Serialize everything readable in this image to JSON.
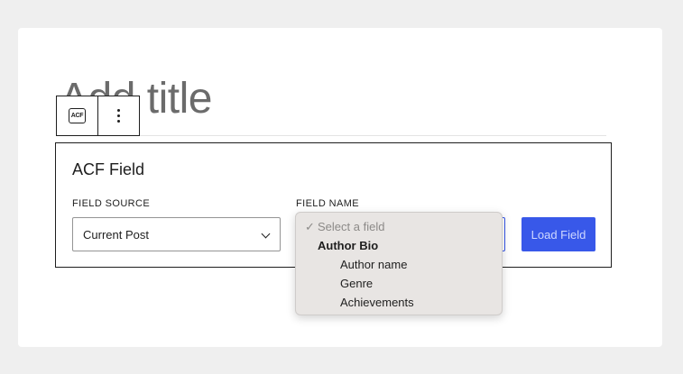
{
  "editor": {
    "title_placeholder": "Add title",
    "toolbar": {
      "block_icon_text": "ACF",
      "more_options": "⋮"
    }
  },
  "acf_block": {
    "heading": "ACF Field",
    "field_source": {
      "label": "FIELD SOURCE",
      "value": "Current Post"
    },
    "field_name": {
      "label": "FIELD NAME",
      "dropdown": {
        "placeholder_check": "✓",
        "placeholder": "Select a field",
        "group_label": "Author Bio",
        "options": [
          "Author name",
          "Genre",
          "Achievements"
        ]
      }
    },
    "load_button": "Load Field"
  },
  "colors": {
    "accent": "#3858e9",
    "page_bg": "#efefef",
    "dropdown_bg": "#e8e5e3"
  }
}
